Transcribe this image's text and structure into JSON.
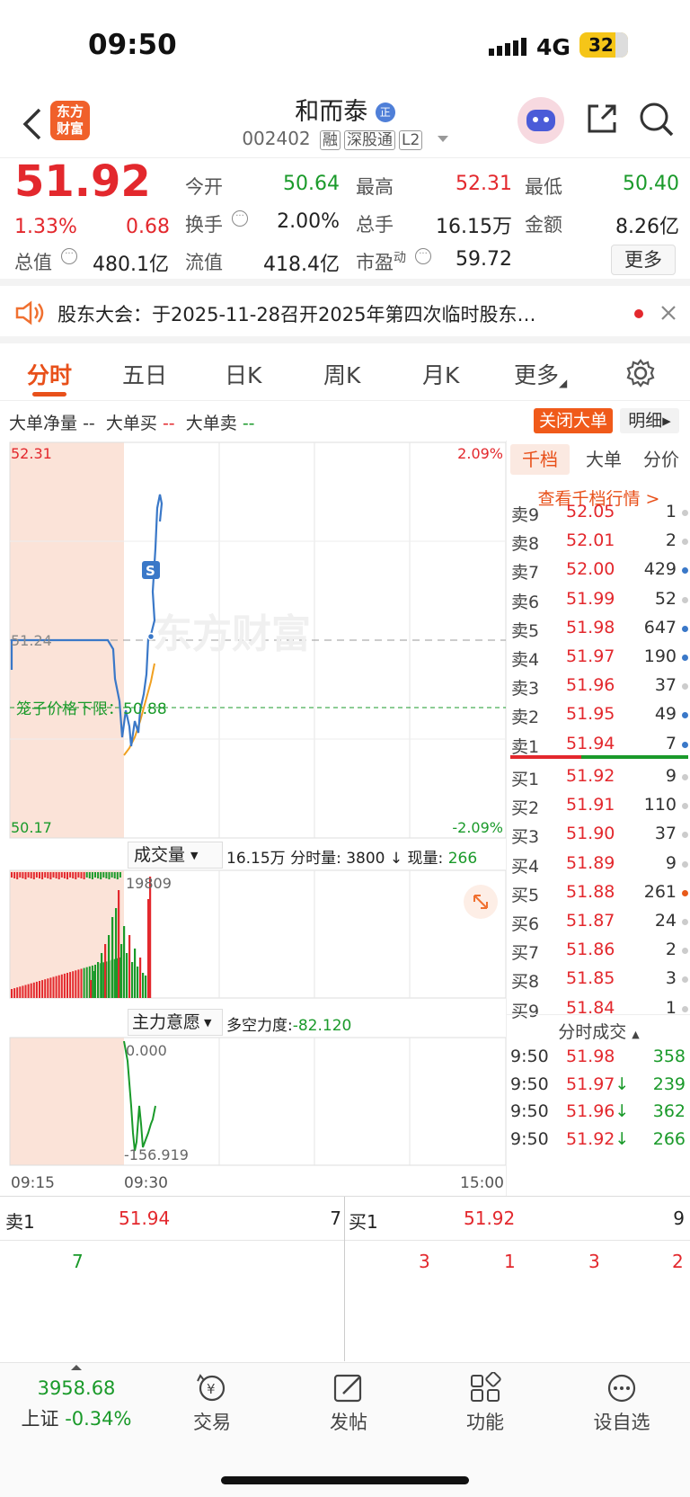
{
  "status": {
    "time": "09:50",
    "network": "4G",
    "battery": "32"
  },
  "header": {
    "logo_text_1": "东方",
    "logo_text_2": "财富",
    "stock_name": "和而泰",
    "badge": "正",
    "code": "002402",
    "tags": [
      "融",
      "深股通",
      "L2"
    ]
  },
  "quote": {
    "price": "51.92",
    "pct": "1.33%",
    "chg": "0.68",
    "open_label": "今开",
    "open": "50.64",
    "high_label": "最高",
    "high": "52.31",
    "low_label": "最低",
    "low": "50.40",
    "turnover_label": "换手",
    "turnover": "2.00%",
    "volume_label": "总手",
    "volume": "16.15万",
    "amount_label": "金额",
    "amount": "8.26亿",
    "mktcap_label": "总值",
    "mktcap": "480.1亿",
    "float_label": "流值",
    "float": "418.4亿",
    "pe_label": "市盈",
    "pe_sup": "动",
    "pe": "59.72",
    "more_label": "更多"
  },
  "notice": {
    "text": "股东大会：于2025-11-28召开2025年第四次临时股东…"
  },
  "tabs": [
    {
      "label": "分时"
    },
    {
      "label": "五日"
    },
    {
      "label": "日K"
    },
    {
      "label": "周K"
    },
    {
      "label": "月K"
    },
    {
      "label": "更多"
    }
  ],
  "indicators": {
    "net": "大单净量",
    "net_v": "--",
    "buy": "大单买",
    "buy_v": "--",
    "sell": "大单卖",
    "sell_v": "--",
    "close_btn": "关闭大单",
    "detail_btn": "明细"
  },
  "chart": {
    "price_top": "52.31",
    "price_bottom": "50.17",
    "pct_top": "2.09%",
    "pct_bottom": "-2.09%",
    "prev_close": "51.24",
    "lower_limit_label": "笼子价格下限：",
    "lower_limit": "50.88",
    "watermark": "东方财富",
    "s_marker": "S",
    "vol_selector": "成交量",
    "vol_total": "16.15万",
    "vol_min_label": "分时量:",
    "vol_min": "3800",
    "vol_now_label": "现量:",
    "vol_now": "266",
    "vol_max": "19809",
    "main_selector": "主力意愿",
    "force_label": "多空力度:",
    "force": "-82.120",
    "main_top": "0.000",
    "main_bottom": "-156.919",
    "time_start": "09:15",
    "time_mid": "09:30",
    "time_end": "15:00",
    "colors": {
      "price_line": "#3a78c8",
      "avg_line": "#f0a020",
      "limit_line": "#1a9a2a",
      "preopen_bg": "#fbe3d8"
    }
  },
  "board": {
    "tabs": [
      "千档",
      "大单",
      "分价"
    ],
    "link": "查看千档行情 >",
    "asks": [
      {
        "label": "卖9",
        "price": "52.05",
        "vol": "1",
        "dot": "#ccc"
      },
      {
        "label": "卖8",
        "price": "52.01",
        "vol": "2",
        "dot": "#ccc"
      },
      {
        "label": "卖7",
        "price": "52.00",
        "vol": "429",
        "dot": "#3a78c8"
      },
      {
        "label": "卖6",
        "price": "51.99",
        "vol": "52",
        "dot": "#ccc"
      },
      {
        "label": "卖5",
        "price": "51.98",
        "vol": "647",
        "dot": "#3a78c8"
      },
      {
        "label": "卖4",
        "price": "51.97",
        "vol": "190",
        "dot": "#3a78c8"
      },
      {
        "label": "卖3",
        "price": "51.96",
        "vol": "37",
        "dot": "#ccc"
      },
      {
        "label": "卖2",
        "price": "51.95",
        "vol": "49",
        "dot": "#3a78c8"
      },
      {
        "label": "卖1",
        "price": "51.94",
        "vol": "7",
        "dot": "#3a78c8"
      }
    ],
    "bids": [
      {
        "label": "买1",
        "price": "51.92",
        "vol": "9",
        "dot": "#ccc"
      },
      {
        "label": "买2",
        "price": "51.91",
        "vol": "110",
        "dot": "#ccc"
      },
      {
        "label": "买3",
        "price": "51.90",
        "vol": "37",
        "dot": "#ccc"
      },
      {
        "label": "买4",
        "price": "51.89",
        "vol": "9",
        "dot": "#ccc"
      },
      {
        "label": "买5",
        "price": "51.88",
        "vol": "261",
        "dot": "#e85a1a"
      },
      {
        "label": "买6",
        "price": "51.87",
        "vol": "24",
        "dot": "#ccc"
      },
      {
        "label": "买7",
        "price": "51.86",
        "vol": "2",
        "dot": "#ccc"
      },
      {
        "label": "买8",
        "price": "51.85",
        "vol": "3",
        "dot": "#ccc"
      },
      {
        "label": "买9",
        "price": "51.84",
        "vol": "1",
        "dot": "#ccc"
      }
    ],
    "trades_title": "分时成交",
    "trades": [
      {
        "time": "9:50",
        "price": "51.98",
        "arrow": "",
        "vol": "358"
      },
      {
        "time": "9:50",
        "price": "51.97",
        "arrow": "↓",
        "vol": "239"
      },
      {
        "time": "9:50",
        "price": "51.96",
        "arrow": "↓",
        "vol": "362"
      },
      {
        "time": "9:50",
        "price": "51.92",
        "arrow": "↓",
        "vol": "266"
      }
    ]
  },
  "bottom_quote": {
    "ask_label": "卖1",
    "ask_price": "51.94",
    "ask_vol": "7",
    "bid_label": "买1",
    "bid_price": "51.92",
    "bid_vol": "9",
    "ask_queue": [
      "7"
    ],
    "bid_queue": [
      "3",
      "1",
      "3",
      "2"
    ]
  },
  "nav": {
    "index_value": "3958.68",
    "index_name": "上证",
    "index_pct": "-0.34%",
    "items": [
      "交易",
      "发帖",
      "功能",
      "设自选"
    ]
  }
}
